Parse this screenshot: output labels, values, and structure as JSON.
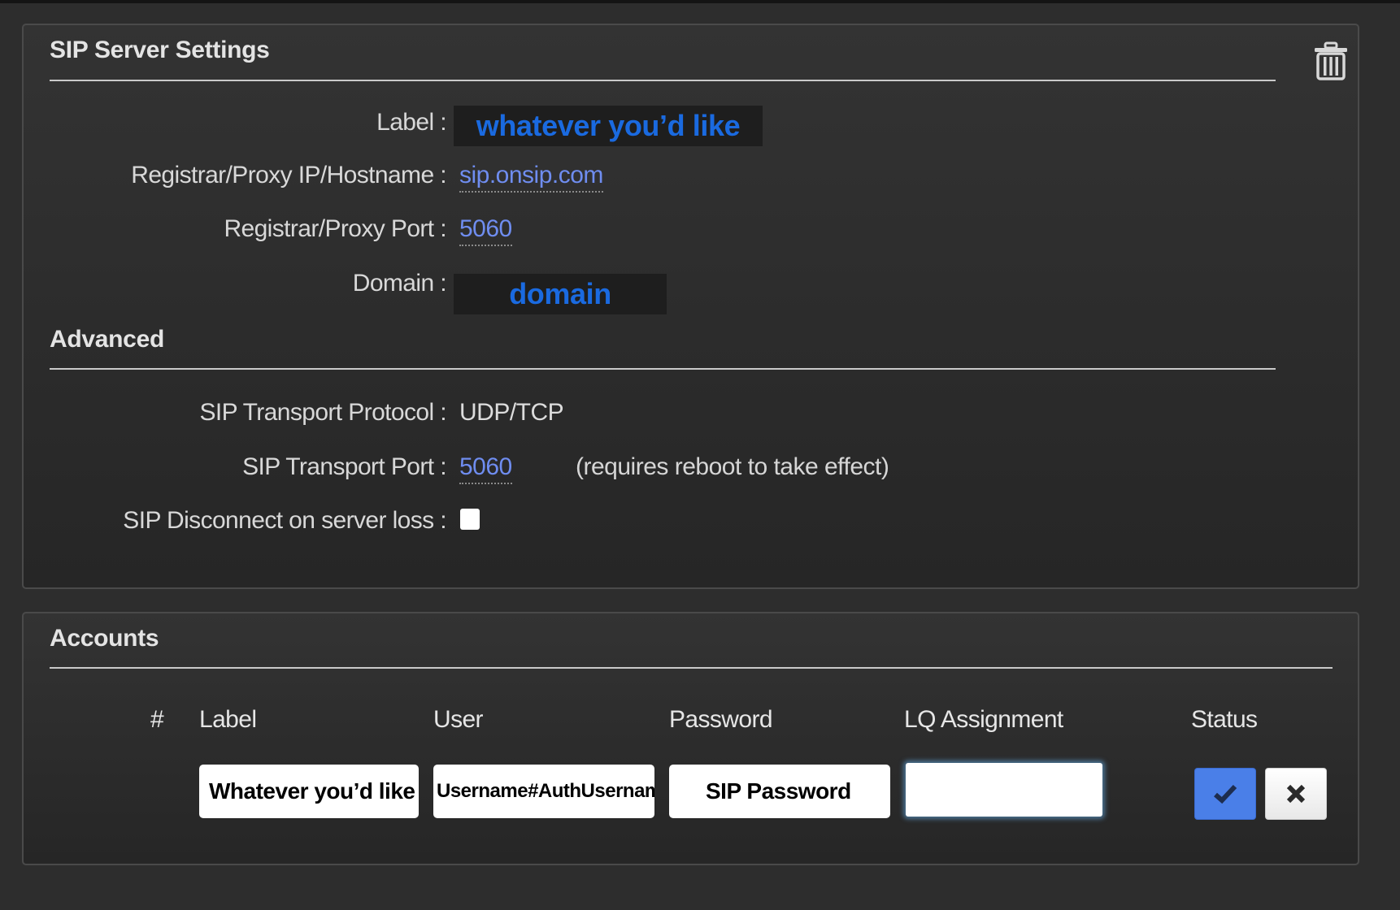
{
  "sip_server": {
    "title": "SIP Server Settings",
    "delete_icon": "trash-icon",
    "fields": {
      "label": {
        "label": "Label :",
        "value": "whatever you’d like"
      },
      "hostname": {
        "label": "Registrar/Proxy IP/Hostname :",
        "value": "sip.onsip.com"
      },
      "port": {
        "label": "Registrar/Proxy Port :",
        "value": "5060"
      },
      "domain": {
        "label": "Domain :",
        "value": "domain"
      }
    },
    "advanced": {
      "title": "Advanced",
      "transport_protocol": {
        "label": "SIP Transport Protocol :",
        "value": "UDP/TCP"
      },
      "transport_port": {
        "label": "SIP Transport Port :",
        "value": "5060",
        "note": "(requires reboot to take effect)"
      },
      "disconnect": {
        "label": "SIP Disconnect on server loss :",
        "checked": false
      }
    }
  },
  "accounts": {
    "title": "Accounts",
    "columns": [
      "#",
      "Label",
      "User",
      "Password",
      "LQ Assignment",
      "Status"
    ],
    "rows": [
      {
        "number": "",
        "label": "Whatever you’d like",
        "user": "Username#AuthUsername",
        "password": "SIP Password",
        "lq_assignment": "",
        "confirm_icon": "check-icon",
        "cancel_icon": "close-icon"
      }
    ]
  },
  "colors": {
    "background": "#2d2d2d",
    "panel": "#2b2b2b",
    "link": "#6f8df0",
    "annotation_blue": "#1a6ae0",
    "confirm_button": "#4a7fe8"
  }
}
